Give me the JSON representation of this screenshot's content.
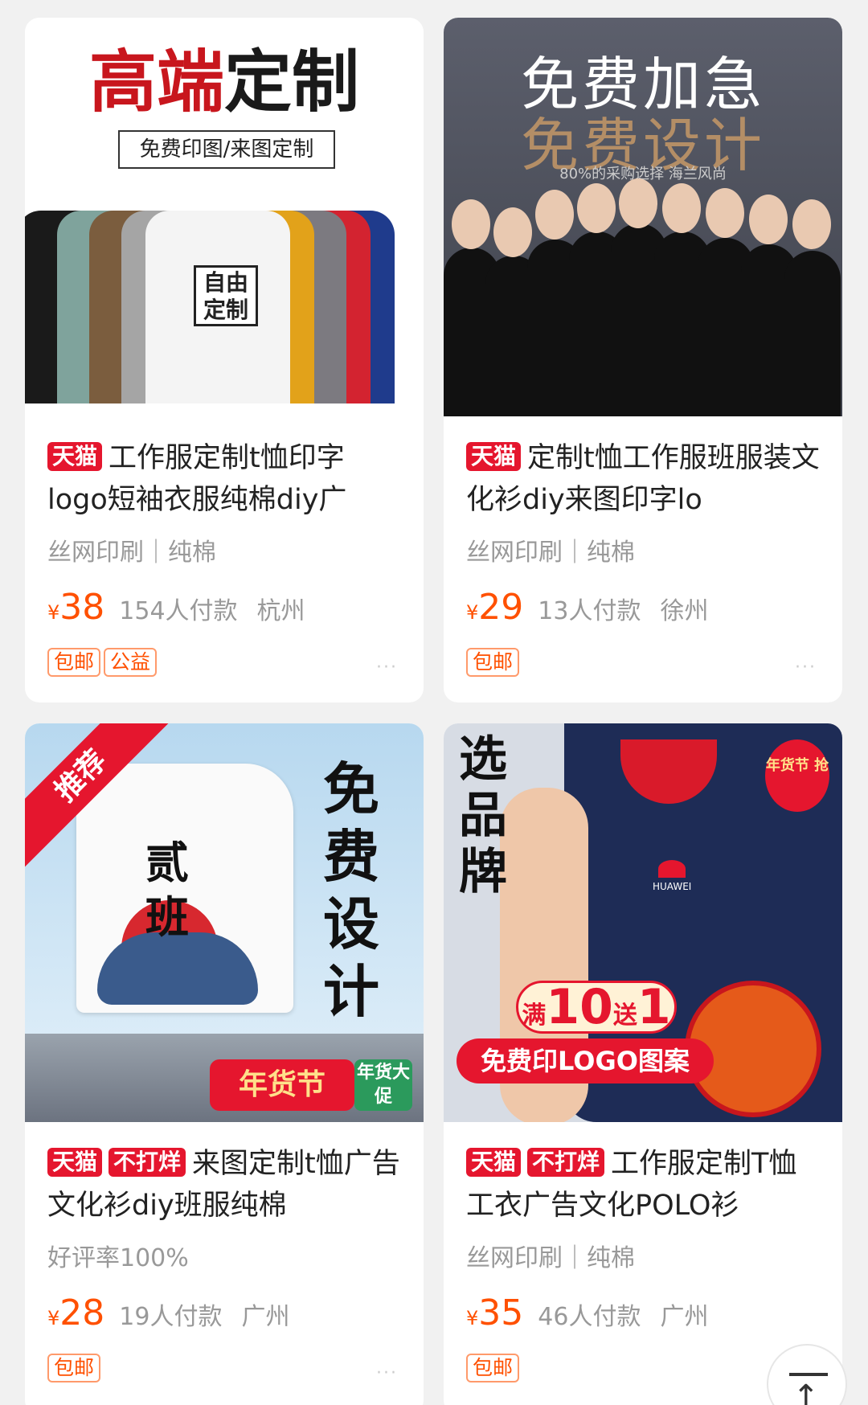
{
  "products": [
    {
      "image": {
        "headline": "高端定制",
        "headline_red": "高端",
        "headline_black": "定制",
        "subtext": "免费印图/来图定制",
        "stamp": "自由定制"
      },
      "badges": [
        "天猫"
      ],
      "title": "工作服定制t恤印字logo短袖衣服纯棉diy广",
      "sub": "丝网印刷｜纯棉",
      "price": "38",
      "sales": "154人付款",
      "location": "杭州",
      "tags": [
        "包邮",
        "公益"
      ]
    },
    {
      "image": {
        "line1": "免费加急",
        "line2": "免费设计",
        "line3": "80%的采购选择 海兰风尚"
      },
      "badges": [
        "天猫"
      ],
      "title": "定制t恤工作服班服装文化衫diy来图印字lo",
      "sub": "丝网印刷｜纯棉",
      "price": "29",
      "sales": "13人付款",
      "location": "徐州",
      "tags": [
        "包邮"
      ]
    },
    {
      "image": {
        "ribbon": "推荐",
        "shirt_text": "贰班",
        "vertical": "免费设计",
        "fest": "年货节",
        "fest2": "年货大促"
      },
      "badges": [
        "天猫",
        "不打烊"
      ],
      "title": "来图定制t恤广告文化衫diy班服纯棉",
      "sub": "好评率100%",
      "price": "28",
      "sales": "19人付款",
      "location": "广州",
      "tags": [
        "包邮"
      ]
    },
    {
      "image": {
        "vertical": "选品牌",
        "brand": "HUAWEI",
        "promo1_big": "10",
        "promo1_pre": "满",
        "promo1_mid": "送",
        "promo1_end": "1",
        "promo2": "免费印LOGO图案",
        "newyear": "年货节 抢"
      },
      "badges": [
        "天猫",
        "不打烊"
      ],
      "title": "工作服定制T恤工衣广告文化POLO衫",
      "sub": "丝网印刷｜纯棉",
      "price": "35",
      "sales": "46人付款",
      "location": "广州",
      "tags": [
        "包邮"
      ]
    }
  ],
  "currency": "¥",
  "more_icon": "···",
  "back_to_top_icon": "back-to-top-icon",
  "colors": {
    "accent": "#ff5000",
    "tmall": "#e5162e"
  }
}
